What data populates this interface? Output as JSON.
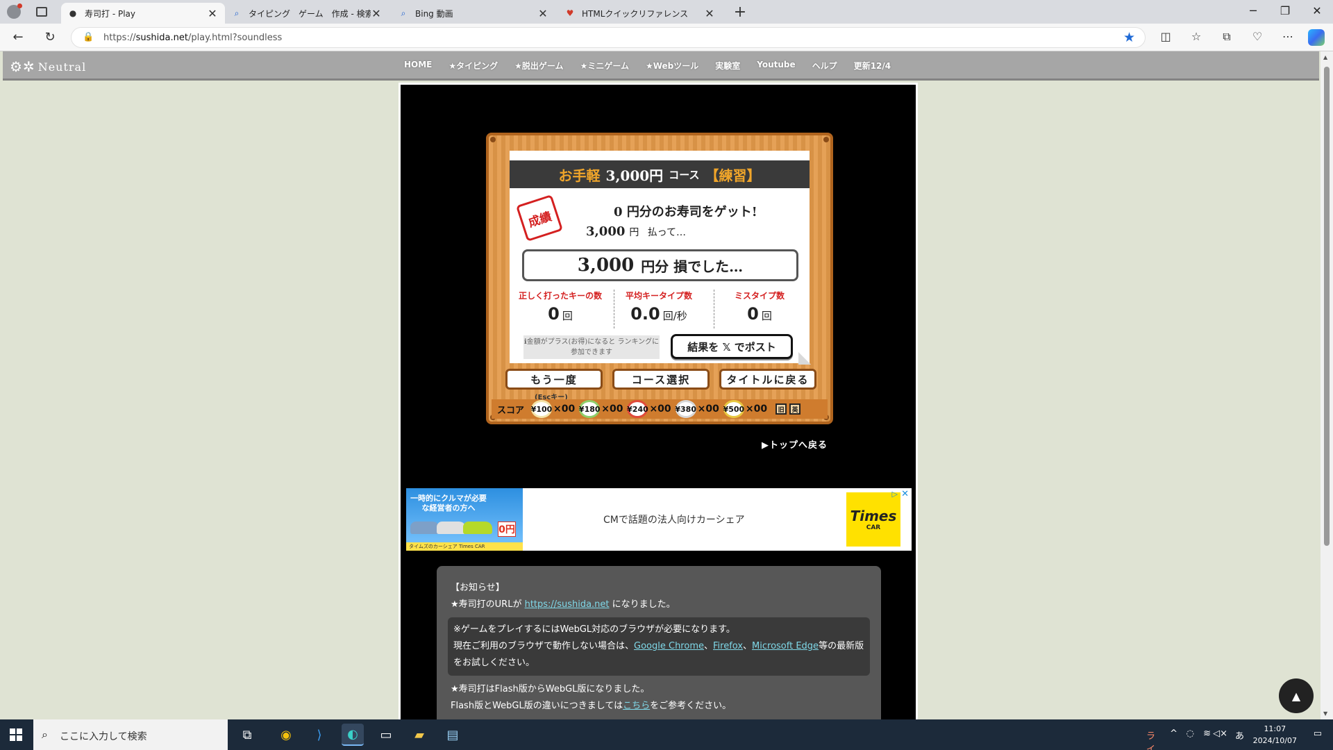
{
  "browser": {
    "tabs": [
      {
        "title": "寿司打 - Play",
        "icon": "sushi-favicon",
        "active": true
      },
      {
        "title": "タイピング　ゲーム　作成 - 検索",
        "icon": "search-favicon",
        "active": false
      },
      {
        "title": "Bing 動画",
        "icon": "search-favicon",
        "active": false
      },
      {
        "title": "HTMLクイックリファレンス",
        "icon": "heart-favicon",
        "active": false
      }
    ],
    "url_prefix": "https://",
    "url_host": "sushida.net",
    "url_path": "/play.html?soundless"
  },
  "site": {
    "logo": "Neutral",
    "menu": [
      "HOME",
      "★タイピング",
      "★脱出ゲーム",
      "★ミニゲーム",
      "★Webツール",
      "実験室",
      "Youtube",
      "ヘルプ",
      "更新12/4"
    ]
  },
  "game": {
    "course": {
      "prefix": "お手軽",
      "amount": "3,000円",
      "suffix": "コース",
      "mode": "【練習】"
    },
    "stamp": "成績",
    "got_amount": "0",
    "got_text": "円分のお寿司をゲット!",
    "paid_amount": "3,000",
    "paid_unit": "円",
    "paid_text": "払って…",
    "loss_amount": "3,000",
    "loss_text": "円分 損でした…",
    "stats": [
      {
        "label": "正しく打ったキーの数",
        "value": "0",
        "unit": "回"
      },
      {
        "label": "平均キータイプ数",
        "value": "0.0",
        "unit": "回/秒"
      },
      {
        "label": "ミスタイプ数",
        "value": "0",
        "unit": "回"
      }
    ],
    "note": "ℹ金額がプラス(お得)になると ランキングに参加できます",
    "post_button": "結果を 𝕏 でポスト",
    "buttons": {
      "retry": "もう一度",
      "course": "コース選択",
      "title": "タイトルに戻る"
    },
    "esc_hint": "(Escキー)",
    "score_label": "スコア",
    "plates": [
      {
        "price": "¥100",
        "count": "×00",
        "color": "#f3e3a8"
      },
      {
        "price": "¥180",
        "count": "×00",
        "color": "#8fce6a"
      },
      {
        "price": "¥240",
        "count": "×00",
        "color": "#e04a3a"
      },
      {
        "price": "¥380",
        "count": "×00",
        "color": "#d8d8d8"
      },
      {
        "price": "¥500",
        "count": "×00",
        "color": "#e8c840"
      }
    ],
    "icons": [
      "旧",
      "英"
    ],
    "top_link": "▶トップへ戻る"
  },
  "ad": {
    "headline": "一時的にクルマが必要な経営者の方へ",
    "price_badge": "0円",
    "footer": "タイムズのカーシェア Times CAR",
    "text": "CMで話題の法人向けカーシェア",
    "logo_main": "Times",
    "logo_sub": "CAR"
  },
  "info": {
    "heading": "【お知らせ】",
    "l1_pre": "★寿司打のURLが",
    "l1_link": "https://sushida.net",
    "l1_post": "になりました。",
    "i1": "※ゲームをプレイするにはWebGL対応のブラウザが必要になります。",
    "i2_pre": "現在ご利用のブラウザで動作しない場合は、",
    "i2_l1": "Google Chrome",
    "i2_sep1": "、",
    "i2_l2": "Firefox",
    "i2_sep2": "、",
    "i2_l3": "Microsoft Edge",
    "i2_post": "等の最新版をお試しください。",
    "l3": "★寿司打はFlash版からWebGL版になりました。",
    "l4_pre": "Flash版とWebGL版の違いにつきましては",
    "l4_link": "こちら",
    "l4_post": "をご参考ください。"
  },
  "taskbar": {
    "search_placeholder": "ここに入力して検索",
    "live_label": "ライブ",
    "time": "11:07",
    "date": "2024/10/07"
  }
}
